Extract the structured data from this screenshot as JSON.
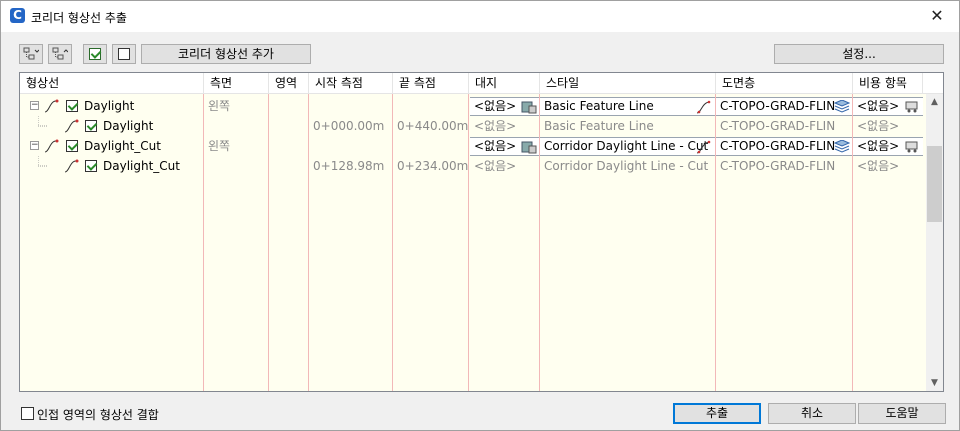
{
  "window": {
    "title": "코리더 형상선 추출",
    "app_icon": "C",
    "close_glyph": "✕"
  },
  "toolbar": {
    "add_button_label": "코리더 형상선 추가",
    "settings_button_label": "설정..."
  },
  "grid": {
    "columns": [
      "형상선",
      "측면",
      "영역",
      "시작 측점",
      "끝 측점",
      "대지",
      "스타일",
      "도면층",
      "비용 항목"
    ],
    "rows": [
      {
        "level": 0,
        "name": "Daylight",
        "side": "왼쪽",
        "region": "",
        "start": "",
        "end": "",
        "site": "<없음>",
        "style": "Basic Feature Line",
        "layer": "C-TOPO-GRAD-FLIN",
        "pay_item": "<없음>",
        "editable": true
      },
      {
        "level": 1,
        "name": "Daylight",
        "side": "",
        "region": "",
        "start": "0+000.00m",
        "end": "0+440.00m",
        "site": "<없음>",
        "style": "Basic Feature Line",
        "layer": "C-TOPO-GRAD-FLIN",
        "pay_item": "<없음>",
        "editable": false
      },
      {
        "level": 0,
        "name": "Daylight_Cut",
        "side": "왼쪽",
        "region": "",
        "start": "",
        "end": "",
        "site": "<없음>",
        "style": "Corridor Daylight Line - Cut",
        "layer": "C-TOPO-GRAD-FLIN",
        "pay_item": "<없음>",
        "editable": true
      },
      {
        "level": 1,
        "name": "Daylight_Cut",
        "side": "",
        "region": "",
        "start": "0+128.98m",
        "end": "0+234.00m",
        "site": "<없음>",
        "style": "Corridor Daylight Line - Cut",
        "layer": "C-TOPO-GRAD-FLIN",
        "pay_item": "<없음>",
        "editable": false
      }
    ]
  },
  "footer": {
    "merge_checkbox_label": "인접 영역의 형상선 결합",
    "extract_button_label": "추출",
    "cancel_button_label": "취소",
    "help_button_label": "도움말"
  },
  "colors": {
    "grid_background": "#fffff0",
    "column_line": "#f2b8b8",
    "default_button_border": "#0078d7",
    "checkmark": "#2a8a2a"
  }
}
